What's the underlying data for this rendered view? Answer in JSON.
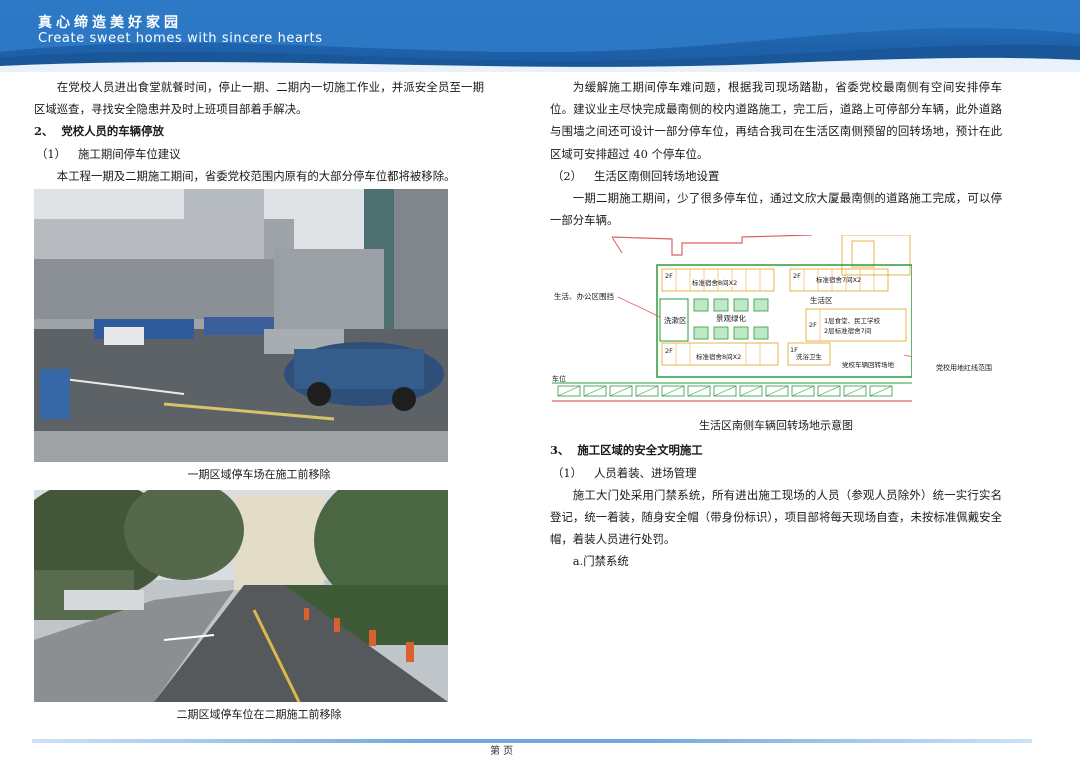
{
  "header": {
    "slogan_cn": "真心缔造美好家园",
    "slogan_en": "Create sweet homes with sincere hearts"
  },
  "left": {
    "para1": "在党校人员进出食堂就餐时间，停止一期、二期内一切施工作业，并派安全员至一期区域巡查，寻找安全隐患并及时上班项目部着手解决。",
    "h2_num": "2、",
    "h2_text": "党校人员的车辆停放",
    "sub1_num": "（1）",
    "sub1_text": "施工期间停车位建议",
    "para2": "本工程一期及二期施工期间，省委党校范围内原有的大部分停车位都将被移除。",
    "caption1": "一期区域停车场在施工前移除",
    "caption2": "二期区域停车位在二期施工前移除"
  },
  "right": {
    "para1": "为缓解施工期间停车难问题，根据我司现场踏勘，省委党校最南侧有空间安排停车位。建议业主尽快完成最南侧的校内道路施工，完工后，道路上可停部分车辆，此外道路与围墙之间还可设计一部分停车位，再结合我司在生活区南侧预留的回转场地，预计在此区域可安排超过 40 个停车位。",
    "sub2_num": "（2）",
    "sub2_text": "生活区南侧回转场地设置",
    "para2": "一期二期施工期间，少了很多停车位，通过文欣大厦最南侧的道路施工完成，可以停一部分车辆。",
    "map_caption": "生活区南侧车辆回转场地示意图",
    "h3_num": "3、",
    "h3_text": "施工区域的安全文明施工",
    "sub3_num": "（1）",
    "sub3_text": "人员着装、进场管理",
    "para3": "施工大门处采用门禁系统，所有进出施工现场的人员（参观人员除外）统一实行实名登记，统一着装，随身安全帽（带身份标识），项目部将每天现场自查，未按标准佩戴安全帽，着装人员进行处罚。",
    "item_a": "a.门禁系统"
  },
  "map": {
    "label_living_office": "生活、办公区围挡",
    "label_wash": "洗漱区",
    "label_landscape": "景观绿化",
    "label_living": "生活区",
    "label_2f_a": "2F",
    "label_dorm_a": "标准宿舍8间X2",
    "label_2f_b": "2F",
    "label_dorm_b": "标准宿舍7间X2",
    "label_2f_c": "2F",
    "label_dorm_c": "标准宿舍8间X2",
    "label_1f": "1F",
    "label_toilet": "洗浴卫生",
    "label_2f_d": "2F",
    "label_canteen_1": "1层食堂、民工学校",
    "label_canteen_2": "2层标准宿舍7间",
    "label_turn": "党校车辆回转场地",
    "label_redline": "党校用地红线范围",
    "label_parking": "车位"
  },
  "footer": {
    "page": "第    页"
  },
  "colors": {
    "banner_blue": "#1f63ad",
    "plan_green": "#2e9b3a",
    "plan_red": "#e04848"
  }
}
